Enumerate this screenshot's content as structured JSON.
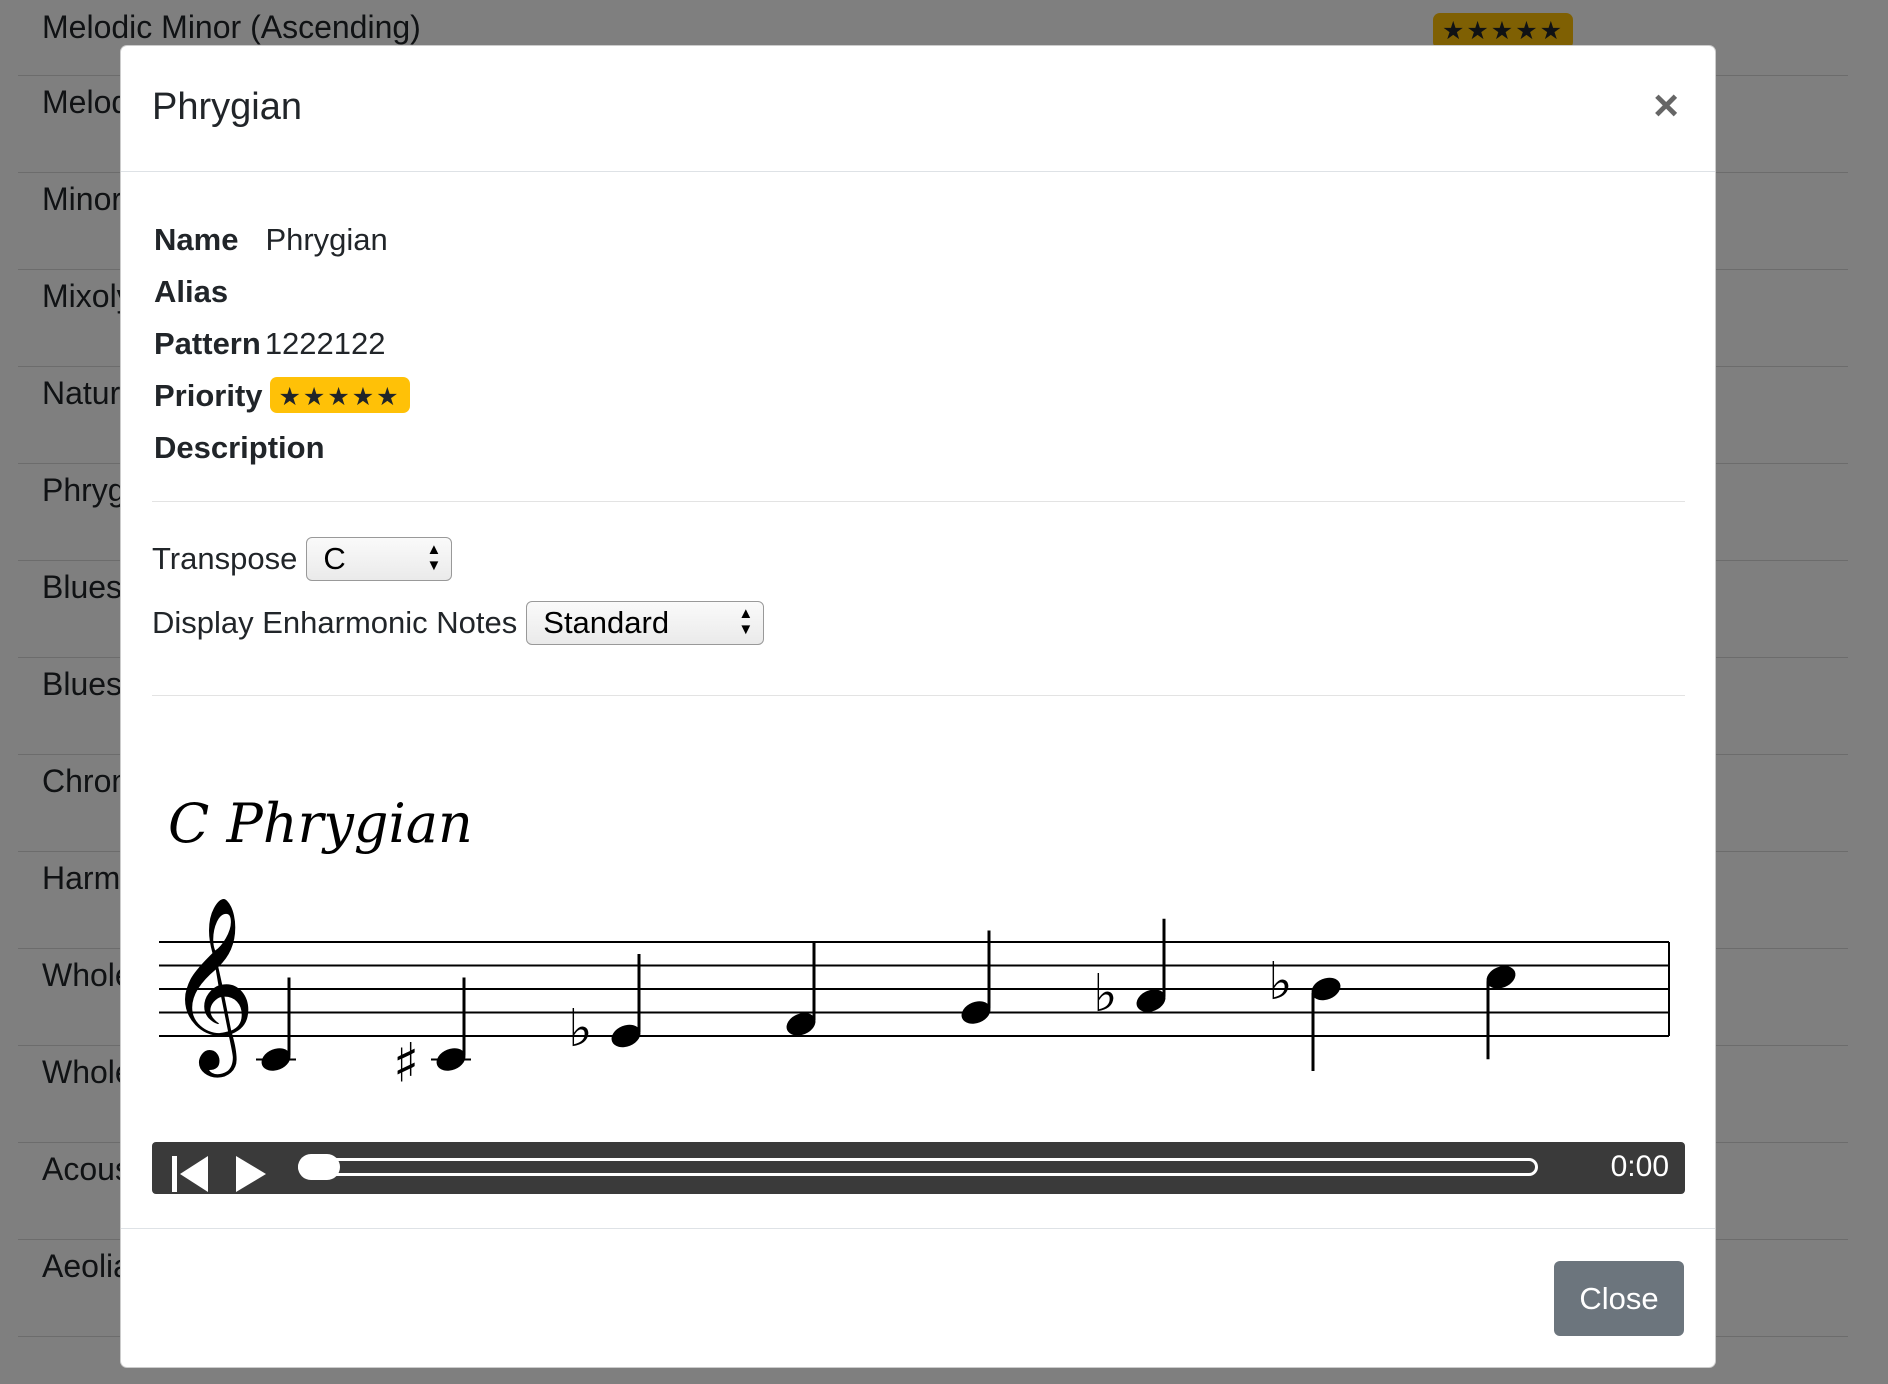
{
  "background_list": {
    "items": [
      {
        "label": "Melodic Minor (Ascending)",
        "priority": "★★★★★"
      },
      {
        "label": "Melodic Minor (Descending)"
      },
      {
        "label": "Minor Pentatonic"
      },
      {
        "label": "Mixolydian"
      },
      {
        "label": "Natural Minor"
      },
      {
        "label": "Phrygian"
      },
      {
        "label": "Blues"
      },
      {
        "label": "Blues"
      },
      {
        "label": "Chromatic"
      },
      {
        "label": "Harmonic Minor"
      },
      {
        "label": "Whole Tone"
      },
      {
        "label": "Whole Half Diminished"
      },
      {
        "label": "Acoustic"
      },
      {
        "label": "Aeolian"
      }
    ]
  },
  "modal": {
    "title": "Phrygian",
    "close_icon": "×",
    "fields": {
      "name_label": "Name",
      "name_value": "Phrygian",
      "alias_label": "Alias",
      "pattern_label": "Pattern",
      "pattern_value": "1222122",
      "priority_label": "Priority",
      "priority_stars": "★★★★★",
      "description_label": "Description"
    },
    "controls": {
      "transpose_label": "Transpose",
      "transpose_value": "C",
      "enharmonic_label": "Display Enharmonic Notes",
      "enharmonic_value": "Standard"
    },
    "score": {
      "title": "C Phrygian",
      "clef": "treble",
      "notes": [
        {
          "pitch": "C4",
          "accidental": ""
        },
        {
          "pitch": "C#4",
          "accidental": "sharp"
        },
        {
          "pitch": "Eb4",
          "accidental": "flat"
        },
        {
          "pitch": "F4",
          "accidental": ""
        },
        {
          "pitch": "G4",
          "accidental": ""
        },
        {
          "pitch": "Ab4",
          "accidental": "flat"
        },
        {
          "pitch": "Bb4",
          "accidental": "flat"
        },
        {
          "pitch": "C5",
          "accidental": ""
        }
      ]
    },
    "player": {
      "time": "0:00",
      "progress": 0,
      "icons": [
        "skip-back-icon",
        "play-icon"
      ]
    },
    "footer": {
      "close_label": "Close"
    }
  },
  "colors": {
    "badge": "#ffc107",
    "close_button": "#6c757d",
    "player_bg": "#3a3a3a"
  }
}
